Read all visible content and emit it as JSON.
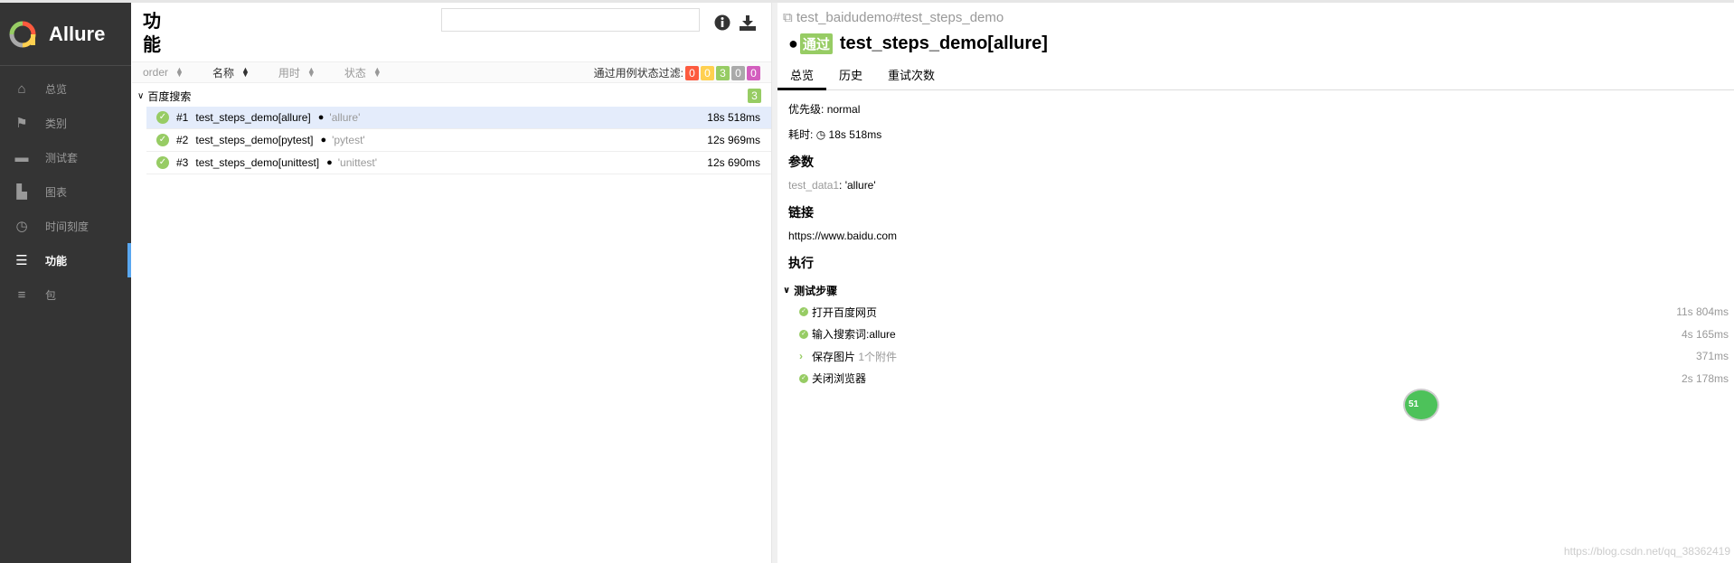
{
  "app": {
    "name": "Allure"
  },
  "sidebar": {
    "items": [
      {
        "label": "总览",
        "icon": "home-icon"
      },
      {
        "label": "类别",
        "icon": "flag-icon"
      },
      {
        "label": "测试套",
        "icon": "briefcase-icon"
      },
      {
        "label": "图表",
        "icon": "bar-chart-icon"
      },
      {
        "label": "时间刻度",
        "icon": "clock-icon"
      },
      {
        "label": "功能",
        "icon": "list-icon",
        "active": true
      },
      {
        "label": "包",
        "icon": "align-left-icon"
      }
    ]
  },
  "middle": {
    "title": "功能",
    "search": {
      "value": "",
      "placeholder": ""
    },
    "sort": [
      "order",
      "名称",
      "用时",
      "状态"
    ],
    "filter_label": "通过用例状态过滤:",
    "filter_badges": [
      {
        "value": "0",
        "color": "#fd5a3e"
      },
      {
        "value": "0",
        "color": "#ffd050"
      },
      {
        "value": "3",
        "color": "#97cc64"
      },
      {
        "value": "0",
        "color": "#aaaaaa"
      },
      {
        "value": "0",
        "color": "#d35ebe"
      }
    ],
    "group": {
      "name": "百度搜索",
      "count": "3"
    },
    "rows": [
      {
        "num": "#1",
        "name": "test_steps_demo[allure]",
        "param": "'allure'",
        "duration": "18s 518ms"
      },
      {
        "num": "#2",
        "name": "test_steps_demo[pytest]",
        "param": "'pytest'",
        "duration": "12s 969ms"
      },
      {
        "num": "#3",
        "name": "test_steps_demo[unittest]",
        "param": "'unittest'",
        "duration": "12s 690ms"
      }
    ]
  },
  "detail": {
    "path": "test_baidudemo#test_steps_demo",
    "status": "通过",
    "title": "test_steps_demo[allure]",
    "tabs": [
      "总览",
      "历史",
      "重试次数"
    ],
    "severity_label": "优先级:",
    "severity": "normal",
    "duration_label": "耗时:",
    "duration": "18s 518ms",
    "params_heading": "参数",
    "param_name": "test_data1",
    "param_value": "'allure'",
    "links_heading": "链接",
    "link": "https://www.baidu.com",
    "exec_heading": "执行",
    "steps_heading": "测试步骤",
    "steps": [
      {
        "name": "打开百度网页",
        "duration": "11s 804ms",
        "status": "passed"
      },
      {
        "name": "输入搜索词:allure",
        "duration": "4s 165ms",
        "status": "passed"
      },
      {
        "name": "保存图片",
        "extra": "1个附件",
        "duration": "371ms",
        "status": "expandable"
      },
      {
        "name": "关闭浏览器",
        "duration": "2s 178ms",
        "status": "passed"
      }
    ]
  },
  "watermark": "https://blog.csdn.net/qq_38362419",
  "bubble": "51"
}
